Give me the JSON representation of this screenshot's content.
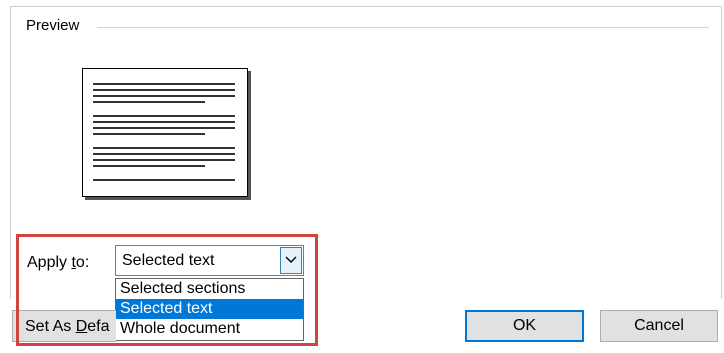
{
  "preview": {
    "label": "Preview"
  },
  "apply_to": {
    "label_prefix": "Apply ",
    "label_accel": "t",
    "label_suffix": "o:",
    "selected_value": "Selected text",
    "options": [
      "Selected sections",
      "Selected text",
      "Whole document"
    ],
    "highlighted_option": "Selected text"
  },
  "buttons": {
    "set_default_prefix": "Set As ",
    "set_default_accel": "D",
    "set_default_suffix": "efa",
    "ok": "OK",
    "cancel": "Cancel"
  },
  "colors": {
    "highlight_box": "#d0453f",
    "selection": "#0078d7",
    "button_bg": "#e1e1e1"
  },
  "icons": {
    "combo_arrow": "chevron-down-icon"
  }
}
